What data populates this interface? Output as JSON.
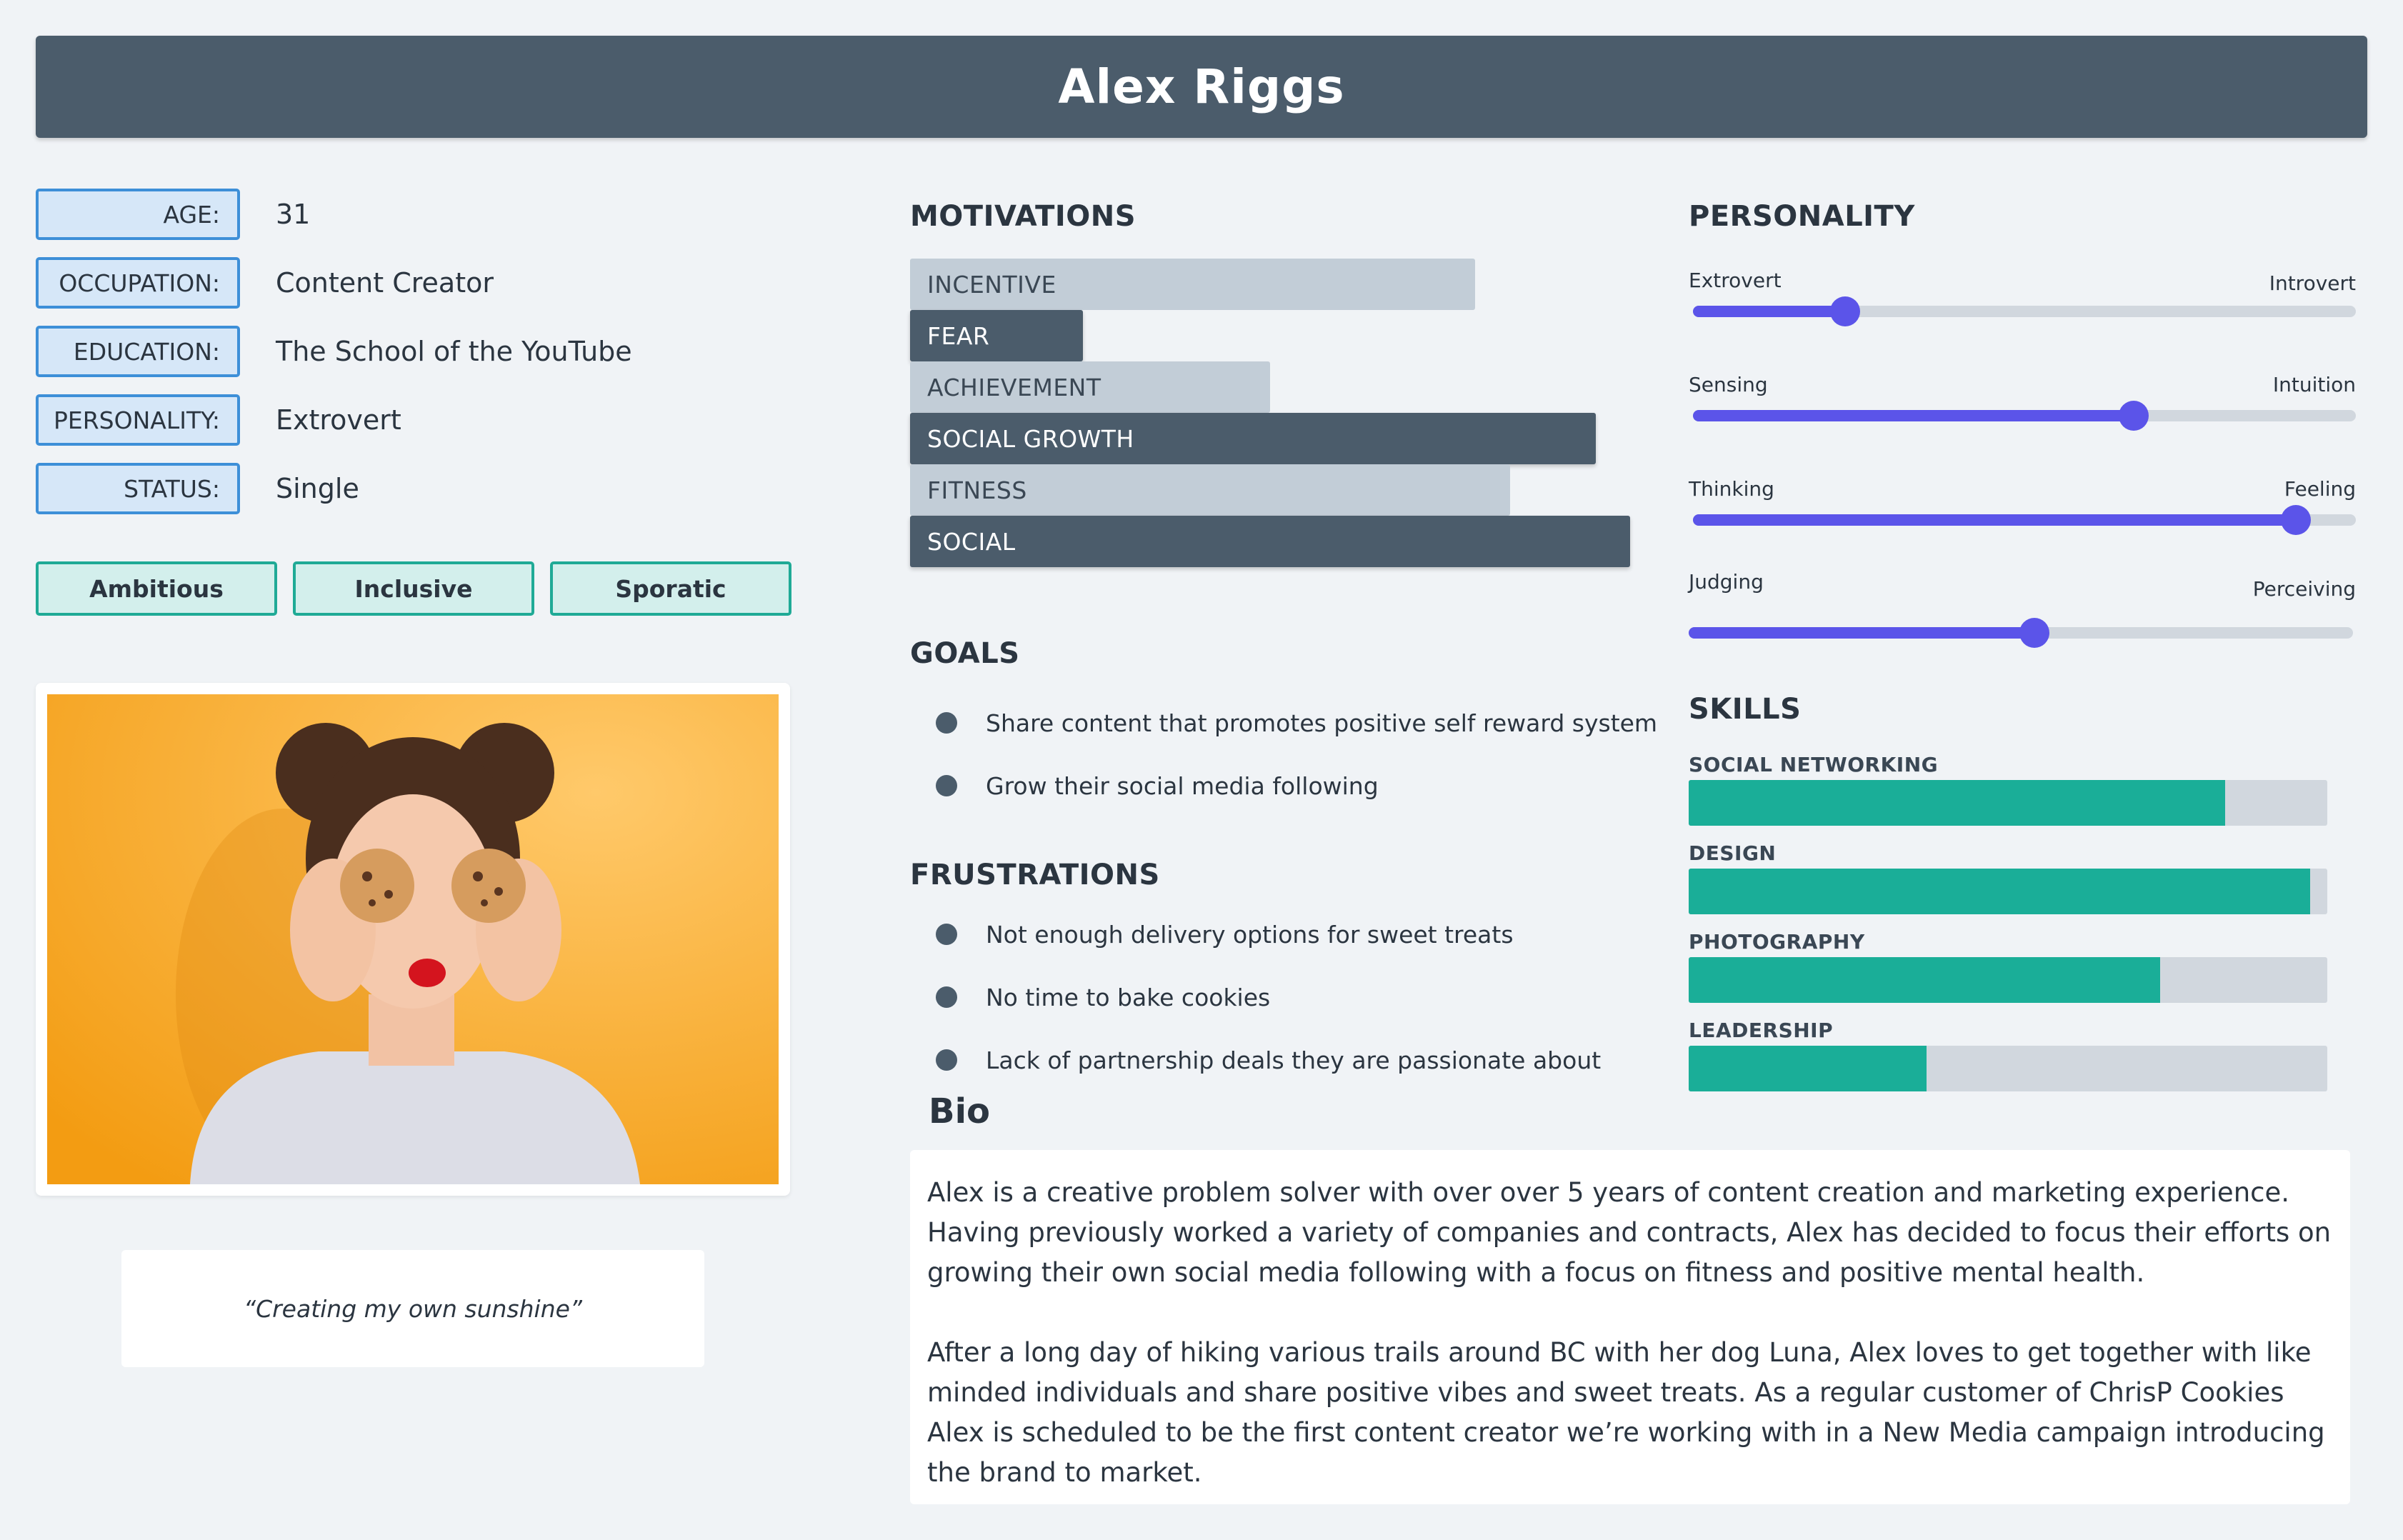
{
  "name": "Alex Riggs",
  "attributes": [
    {
      "label": "AGE:",
      "value": "31"
    },
    {
      "label": "OCCUPATION:",
      "value": "Content Creator"
    },
    {
      "label": "EDUCATION:",
      "value": "The School of the YouTube"
    },
    {
      "label": "PERSONALITY:",
      "value": "Extrovert"
    },
    {
      "label": "STATUS:",
      "value": "Single"
    }
  ],
  "traits": [
    "Ambitious",
    "Inclusive",
    "Sporatic"
  ],
  "quote": "“Creating my own sunshine”",
  "motivations": {
    "title": "MOTIVATIONS",
    "items": [
      {
        "label": "INCENTIVE",
        "value": 0.785,
        "style": "light"
      },
      {
        "label": "FEAR",
        "value": 0.24,
        "style": "dark"
      },
      {
        "label": "ACHIEVEMENT",
        "value": 0.5,
        "style": "light"
      },
      {
        "label": "SOCIAL GROWTH",
        "value": 0.952,
        "style": "dark"
      },
      {
        "label": "FITNESS",
        "value": 0.833,
        "style": "light"
      },
      {
        "label": "SOCIAL",
        "value": 1.0,
        "style": "dark"
      }
    ]
  },
  "goals": {
    "title": "GOALS",
    "items": [
      "Share content that promotes positive self reward system",
      "Grow their social media following"
    ]
  },
  "frustrations": {
    "title": "FRUSTRATIONS",
    "items": [
      "Not enough delivery options for sweet treats",
      "No time to bake cookies",
      "Lack of partnership deals they are passionate about"
    ]
  },
  "personality": {
    "title": "PERSONALITY",
    "scales": [
      {
        "left": "Extrovert",
        "right": "Introvert",
        "value": 0.23
      },
      {
        "left": "Sensing",
        "right": "Intuition",
        "value": 0.665
      },
      {
        "left": "Thinking",
        "right": "Feeling",
        "value": 0.91
      },
      {
        "left": "Judging",
        "right": "Perceiving",
        "value": 0.52
      }
    ]
  },
  "skills": {
    "title": "SKILLS",
    "items": [
      {
        "label": "SOCIAL NETWORKING",
        "value": 0.84
      },
      {
        "label": "DESIGN",
        "value": 0.973
      },
      {
        "label": "PHOTOGRAPHY",
        "value": 0.738
      },
      {
        "label": "LEADERSHIP",
        "value": 0.372
      }
    ]
  },
  "bio": {
    "title": "Bio",
    "paragraphs": [
      "Alex is a creative problem solver with over over 5 years of content creation and marketing experience. Having previously worked a variety of companies and contracts, Alex has decided to focus their efforts on growing their own social media following with a focus on fitness and positive mental health.",
      "After a long day of hiking various trails around BC with her dog Luna, Alex loves to get together with like minded individuals and share positive vibes and sweet treats.  As a regular customer of ChrisP Cookies Alex is scheduled to be the first content creator we’re working with in a New Media campaign introducing the brand to market."
    ]
  },
  "colors": {
    "header": "#4b5c6b",
    "accent_blue": "#3d8fd8",
    "accent_teal": "#1aae98",
    "slider": "#5b54e9",
    "photo_background": "#f5a623"
  }
}
